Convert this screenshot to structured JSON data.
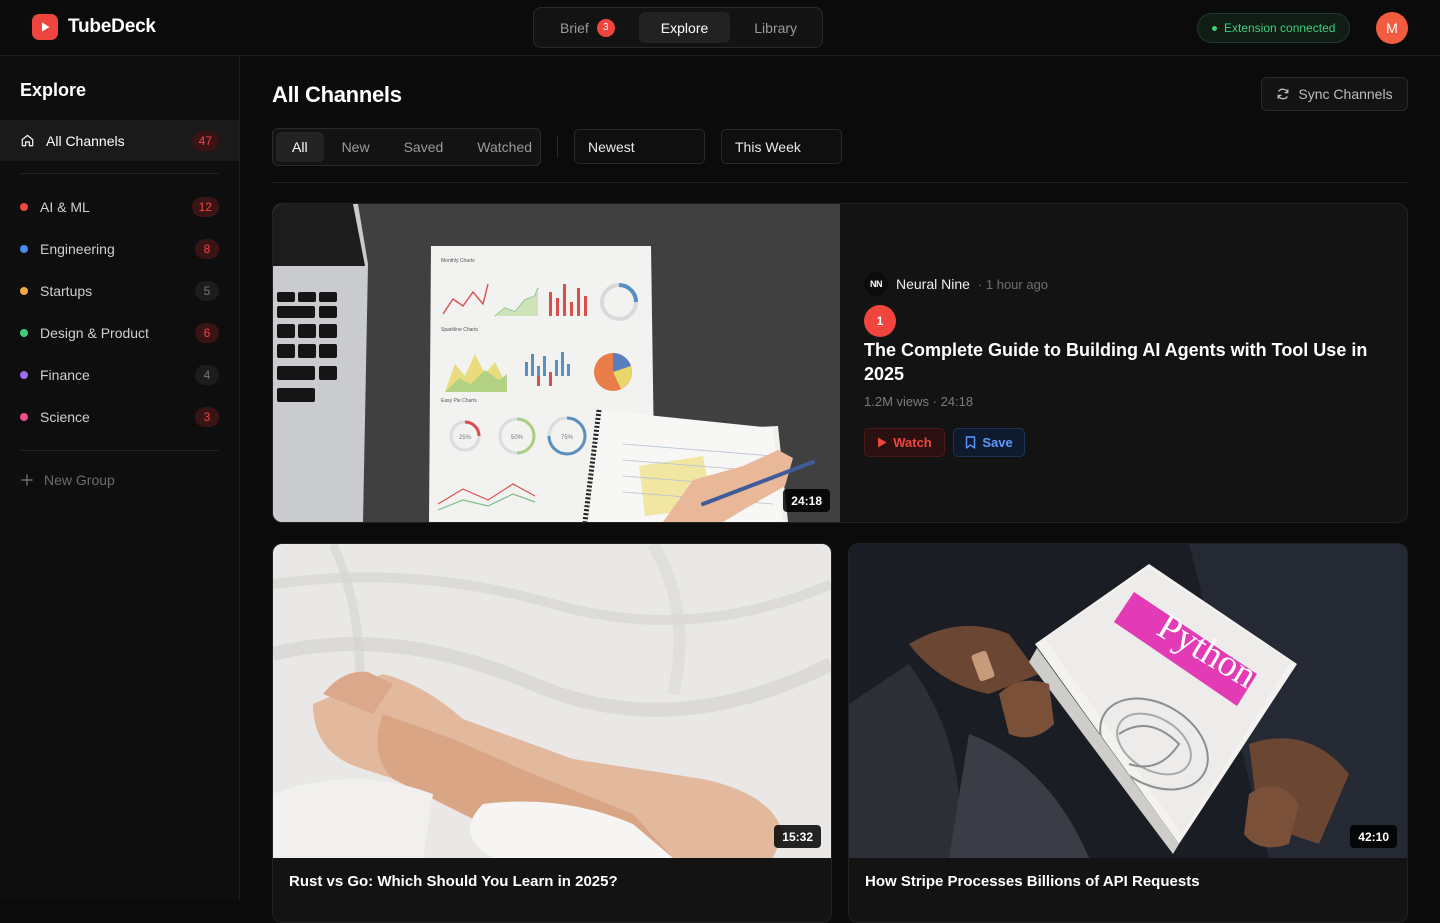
{
  "app": {
    "name": "TubeDeck"
  },
  "nav": {
    "tabs": [
      {
        "label": "Brief",
        "badge": "3"
      },
      {
        "label": "Explore"
      },
      {
        "label": "Library"
      }
    ]
  },
  "extension": {
    "status": "Extension connected"
  },
  "user": {
    "initial": "M"
  },
  "sidebar": {
    "title": "Explore",
    "all": {
      "label": "All Channels",
      "count": "47"
    },
    "groups": [
      {
        "label": "AI & ML",
        "count": "12",
        "color": "#f0443e"
      },
      {
        "label": "Engineering",
        "count": "8",
        "color": "#4a8cf0"
      },
      {
        "label": "Startups",
        "count": "5",
        "color": "#f0a93e"
      },
      {
        "label": "Design & Product",
        "count": "6",
        "color": "#3ecf7a"
      },
      {
        "label": "Finance",
        "count": "4",
        "color": "#9b6cf0"
      },
      {
        "label": "Science",
        "count": "3",
        "color": "#f04e8c"
      }
    ],
    "new_group": "New Group"
  },
  "main": {
    "title": "All Channels",
    "sync_label": "Sync Channels",
    "filters": [
      "All",
      "New",
      "Saved",
      "Watched"
    ],
    "sort_value": "Newest",
    "period_value": "This Week"
  },
  "featured": {
    "channel_logo": "NN",
    "channel": "Neural Nine",
    "time": "· 1 hour ago",
    "rank": "1",
    "title": "The Complete Guide to Building AI Agents with Tool Use in 2025",
    "meta": "1.2M views · 24:18",
    "duration": "24:18",
    "watch_label": "Watch",
    "save_label": "Save",
    "thumb_chart_labels": {
      "title_line": "Monthly Charts",
      "sparkline": "Sparkline Charts",
      "easy_pie": "Easy Pie Charts",
      "pct1": "25%",
      "pct2": "50%",
      "pct3": "75%"
    }
  },
  "cards": [
    {
      "title": "Rust vs Go: Which Should You Learn in 2025?",
      "duration": "15:32"
    },
    {
      "title": "How Stripe Processes Billions of API Requests",
      "duration": "42:10",
      "book_title": "Python"
    }
  ]
}
